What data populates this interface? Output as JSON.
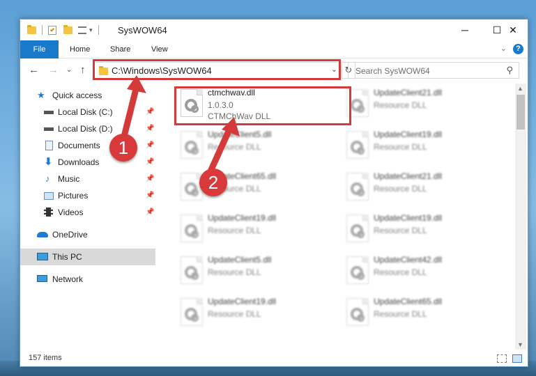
{
  "window": {
    "title": "SysWOW64",
    "minimize_glyph": "─",
    "maximize_glyph": "☐",
    "close_glyph": "✕"
  },
  "ribbon": {
    "tabs": [
      "File",
      "Home",
      "Share",
      "View"
    ],
    "help_glyph": "?",
    "collapse_glyph": "⌄"
  },
  "address": {
    "path": "C:\\Windows\\SysWOW64",
    "search_placeholder": "Search SysWOW64",
    "back_glyph": "←",
    "forward_glyph": "→",
    "recent_glyph": "⌄",
    "up_glyph": "↑",
    "dropdown_glyph": "⌄",
    "refresh_glyph": "↻",
    "search_glyph": "⚲"
  },
  "sidebar": {
    "items": [
      {
        "label": "Quick access",
        "icon": "star-icon"
      },
      {
        "label": "Local Disk (C:)",
        "icon": "drive-icon"
      },
      {
        "label": "Local Disk (D:)",
        "icon": "drive-icon"
      },
      {
        "label": "Documents",
        "icon": "documents-icon"
      },
      {
        "label": "Downloads",
        "icon": "download-icon"
      },
      {
        "label": "Music",
        "icon": "music-icon"
      },
      {
        "label": "Pictures",
        "icon": "pictures-icon"
      },
      {
        "label": "Videos",
        "icon": "videos-icon"
      },
      {
        "label": "OneDrive",
        "icon": "cloud-icon"
      },
      {
        "label": "This PC",
        "icon": "computer-icon"
      },
      {
        "label": "Network",
        "icon": "network-icon"
      }
    ],
    "pin_glyph": "📌"
  },
  "files": [
    {
      "name": "ctmchwav.dll",
      "line1": "1.0.3.0",
      "line2": "CTMChWav DLL"
    },
    {
      "name": "UpdateClient21.dll",
      "line1": "Resource DLL",
      "line2": ""
    },
    {
      "name": "UpdateClient5.dll",
      "line1": "Resource DLL",
      "line2": ""
    },
    {
      "name": "UpdateClient19.dll",
      "line1": "Resource DLL",
      "line2": ""
    },
    {
      "name": "UpdateClient65.dll",
      "line1": "Resource DLL",
      "line2": ""
    },
    {
      "name": "UpdateClient21.dll",
      "line1": "Resource DLL",
      "line2": ""
    },
    {
      "name": "UpdateClient19.dll",
      "line1": "Resource DLL",
      "line2": ""
    },
    {
      "name": "UpdateClient19.dll",
      "line1": "Resource DLL",
      "line2": ""
    },
    {
      "name": "UpdateClient5.dll",
      "line1": "Resource DLL",
      "line2": ""
    },
    {
      "name": "UpdateClient42.dll",
      "line1": "Resource DLL",
      "line2": ""
    },
    {
      "name": "UpdateClient19.dll",
      "line1": "Resource DLL",
      "line2": ""
    },
    {
      "name": "UpdateClient65.dll",
      "line1": "Resource DLL",
      "line2": ""
    }
  ],
  "status": {
    "items_count": "157 items"
  },
  "callouts": {
    "step1": "1",
    "step2": "2",
    "color": "#d53a3a"
  }
}
